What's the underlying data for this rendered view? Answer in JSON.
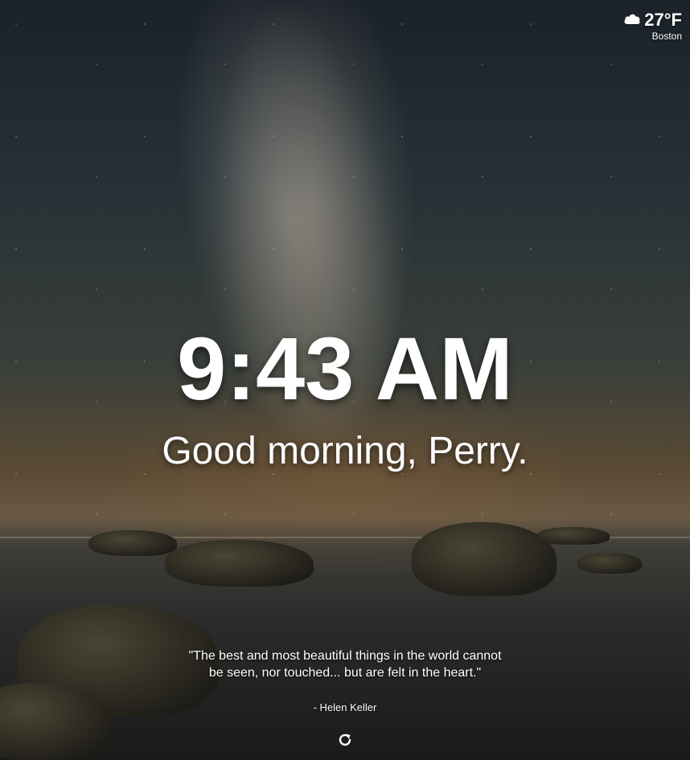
{
  "weather": {
    "icon": "cloud-icon",
    "temperature": "27°F",
    "location": "Boston"
  },
  "clock": {
    "time": "9:43 AM"
  },
  "greeting": {
    "text": "Good morning, Perry."
  },
  "quote": {
    "text": "\"The best and most beautiful things in the world cannot be seen, nor touched... but are felt in the heart.\"",
    "author": "- Helen Keller"
  },
  "controls": {
    "refresh_icon": "refresh-icon"
  }
}
